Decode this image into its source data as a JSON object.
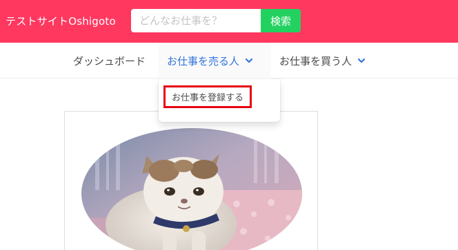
{
  "header": {
    "site_title": "テストサイトOshigoto",
    "search_placeholder": "どんなお仕事を？",
    "search_button": "検索",
    "background_color": "#ff3860",
    "button_color": "#23d160"
  },
  "nav": {
    "items": [
      {
        "label": "ダッシュボード",
        "has_dropdown": false
      },
      {
        "label": "お仕事を売る人",
        "has_dropdown": true,
        "active": true
      },
      {
        "label": "お仕事を買う人",
        "has_dropdown": true
      }
    ],
    "active_color": "#3273dc"
  },
  "dropdown": {
    "items": [
      {
        "label": "お仕事を登録する",
        "highlighted": true
      }
    ],
    "highlight_color": "#e50012"
  },
  "card": {
    "image_subject": "cat-photo"
  }
}
